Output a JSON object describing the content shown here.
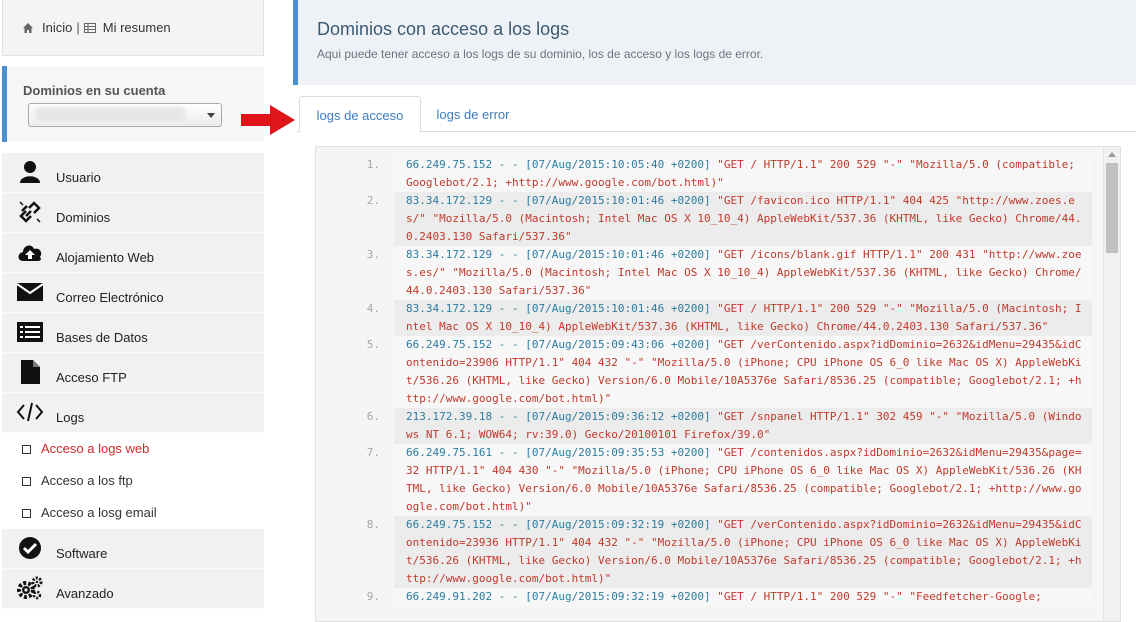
{
  "breadcrumb": {
    "home": "Inicio",
    "summary": "Mi resumen"
  },
  "domains": {
    "label": "Dominios en su cuenta",
    "selected": ""
  },
  "menu": [
    {
      "label": "Usuario",
      "icon": "user-icon"
    },
    {
      "label": "Dominios",
      "icon": "broken-link-icon"
    },
    {
      "label": "Alojamiento Web",
      "icon": "cloud-upload-icon"
    },
    {
      "label": "Correo Electrónico",
      "icon": "envelope-icon"
    },
    {
      "label": "Bases de Datos",
      "icon": "list-icon"
    },
    {
      "label": "Acceso FTP",
      "icon": "file-icon"
    },
    {
      "label": "Logs",
      "icon": "code-icon"
    }
  ],
  "submenu": [
    {
      "label": "Acceso a logs web",
      "active": true
    },
    {
      "label": "Acceso a los ftp",
      "active": false
    },
    {
      "label": "Acceso a losg email",
      "active": false
    }
  ],
  "menu2": [
    {
      "label": "Software",
      "icon": "check-circle-icon"
    },
    {
      "label": "Avanzado",
      "icon": "gears-icon"
    }
  ],
  "header": {
    "title": "Dominios con acceso a los logs",
    "subtitle": "Aqui puede tener acceso a los logs de su dominio, los de acceso y los logs de error."
  },
  "tabs": {
    "access": "logs de acceso",
    "error": "logs de error"
  },
  "logs": [
    {
      "num": "1.",
      "pre": "66.249.75.152 - - [07/Aug/2015:10:05:40 +0200] ",
      "req": "\"GET / HTTP/1.1\" 200 529 \"-\" \"Mozilla/5.0 (compatible; Googlebot/2.1; +http://www.google.com/bot.html)\""
    },
    {
      "num": "2.",
      "pre": "83.34.172.129 - - [07/Aug/2015:10:01:46 +0200] ",
      "req": "\"GET /favicon.ico HTTP/1.1\" 404 425 \"http://www.zoes.es/\" \"Mozilla/5.0 (Macintosh; Intel Mac OS X 10_10_4) AppleWebKit/537.36 (KHTML, like Gecko) Chrome/44.0.2403.130 Safari/537.36\""
    },
    {
      "num": "3.",
      "pre": "83.34.172.129 - - [07/Aug/2015:10:01:46 +0200] ",
      "req": "\"GET /icons/blank.gif HTTP/1.1\" 200 431 \"http://www.zoes.es/\" \"Mozilla/5.0 (Macintosh; Intel Mac OS X 10_10_4) AppleWebKit/537.36 (KHTML, like Gecko) Chrome/44.0.2403.130 Safari/537.36\""
    },
    {
      "num": "4.",
      "pre": "83.34.172.129 - - [07/Aug/2015:10:01:46 +0200] ",
      "req": "\"GET / HTTP/1.1\" 200 529 \"-\" \"Mozilla/5.0 (Macintosh; Intel Mac OS X 10_10_4) AppleWebKit/537.36 (KHTML, like Gecko) Chrome/44.0.2403.130 Safari/537.36\""
    },
    {
      "num": "5.",
      "pre": "66.249.75.152 - - [07/Aug/2015:09:43:06 +0200] ",
      "req": "\"GET /verContenido.aspx?idDominio=2632&idMenu=29435&idContenido=23906 HTTP/1.1\" 404 432 \"-\" \"Mozilla/5.0 (iPhone; CPU iPhone OS 6_0 like Mac OS X) AppleWebKit/536.26 (KHTML, like Gecko) Version/6.0 Mobile/10A5376e Safari/8536.25 (compatible; Googlebot/2.1; +http://www.google.com/bot.html)\""
    },
    {
      "num": "6.",
      "pre": "213.172.39.18 - - [07/Aug/2015:09:36:12 +0200] ",
      "req": "\"GET /snpanel HTTP/1.1\" 302 459 \"-\" \"Mozilla/5.0 (Windows NT 6.1; WOW64; rv:39.0) Gecko/20100101 Firefox/39.0\""
    },
    {
      "num": "7.",
      "pre": "66.249.75.161 - - [07/Aug/2015:09:35:53 +0200] ",
      "req": "\"GET /contenidos.aspx?idDominio=2632&idMenu=29435&page=32 HTTP/1.1\" 404 430 \"-\" \"Mozilla/5.0 (iPhone; CPU iPhone OS 6_0 like Mac OS X) AppleWebKit/536.26 (KHTML, like Gecko) Version/6.0 Mobile/10A5376e Safari/8536.25 (compatible; Googlebot/2.1; +http://www.google.com/bot.html)\""
    },
    {
      "num": "8.",
      "pre": "66.249.75.152 - - [07/Aug/2015:09:32:19 +0200] ",
      "req": "\"GET /verContenido.aspx?idDominio=2632&idMenu=29435&idContenido=23936 HTTP/1.1\" 404 432 \"-\" \"Mozilla/5.0 (iPhone; CPU iPhone OS 6_0 like Mac OS X) AppleWebKit/536.26 (KHTML, like Gecko) Version/6.0 Mobile/10A5376e Safari/8536.25 (compatible; Googlebot/2.1; +http://www.google.com/bot.html)\""
    },
    {
      "num": "9.",
      "pre": "66.249.91.202 - - [07/Aug/2015:09:32:19 +0200] ",
      "req": "\"GET / HTTP/1.1\" 200 529 \"-\" \"Feedfetcher-Google;"
    }
  ],
  "colors": {
    "accent": "#4a8fd0",
    "active_sub": "#d6282c",
    "arrow": "#e0141b",
    "link": "#3b7cc0"
  }
}
